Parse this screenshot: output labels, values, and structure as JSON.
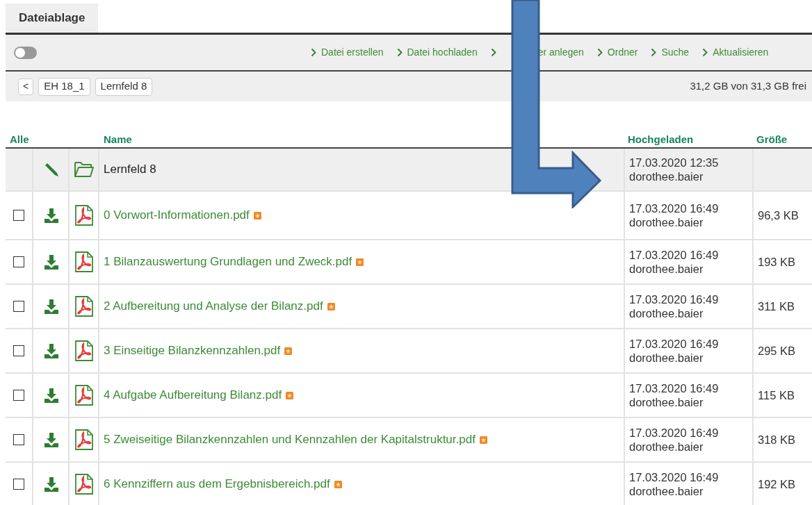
{
  "tab": {
    "label": "Dateiablage",
    "selected": true
  },
  "toolbar": {
    "toggle": {
      "on": false
    },
    "actions": [
      {
        "kind": "link",
        "label": "Datei erstellen"
      },
      {
        "kind": "link",
        "label": "Datei hochladen"
      },
      {
        "kind": "covered_link",
        "label": "er anlegen"
      },
      {
        "kind": "link",
        "label": "Ordner"
      },
      {
        "kind": "link",
        "label": "Suche"
      },
      {
        "kind": "link",
        "label": "Aktualisieren"
      }
    ]
  },
  "breadcrumb": {
    "back": "<",
    "items": [
      "EH 18_1",
      "Lernfeld 8"
    ],
    "storage": "31,2 GB von 31,3 GB frei"
  },
  "table": {
    "columns": {
      "select": "Alle",
      "name": "Name",
      "uploaded": "Hochgeladen",
      "size": "Größe"
    },
    "rows": [
      {
        "kind": "folder",
        "name": "Lernfeld 8",
        "date": "17.03.2020 12:35",
        "user": "dorothee.baier"
      },
      {
        "kind": "pdf",
        "name": "0 Vorwort-Informationen.pdf",
        "new": true,
        "checked": false,
        "date": "17.03.2020 16:49",
        "user": "dorothee.baier",
        "size": "96,3 KB"
      },
      {
        "kind": "pdf",
        "name": "1 Bilanzauswertung Grundlagen und Zweck.pdf",
        "new": true,
        "checked": false,
        "date": "17.03.2020 16:49",
        "user": "dorothee.baier",
        "size": "193 KB"
      },
      {
        "kind": "pdf",
        "name": "2 Aufbereitung und Analyse der Bilanz.pdf",
        "new": true,
        "checked": false,
        "date": "17.03.2020 16:49",
        "user": "dorothee.baier",
        "size": "311 KB"
      },
      {
        "kind": "pdf",
        "name": "3 Einseitige Bilanzkennzahlen.pdf",
        "new": true,
        "checked": false,
        "date": "17.03.2020 16:49",
        "user": "dorothee.baier",
        "size": "295 KB"
      },
      {
        "kind": "pdf",
        "name": "4 Aufgabe Aufbereitung Bilanz.pdf",
        "new": true,
        "checked": false,
        "date": "17.03.2020 16:49",
        "user": "dorothee.baier",
        "size": "115 KB"
      },
      {
        "kind": "pdf",
        "name": "5 Zweiseitige Bilanzkennzahlen und Kennzahlen der Kapitalstruktur.pdf",
        "new": true,
        "checked": false,
        "date": "17.03.2020 16:49",
        "user": "dorothee.baier",
        "size": "318 KB"
      },
      {
        "kind": "pdf",
        "name": "6 Kennziffern aus dem Ergebnisbereich.pdf",
        "new": true,
        "checked": false,
        "date": "17.03.2020 16:49",
        "user": "dorothee.baier",
        "size": "192 KB"
      }
    ]
  }
}
